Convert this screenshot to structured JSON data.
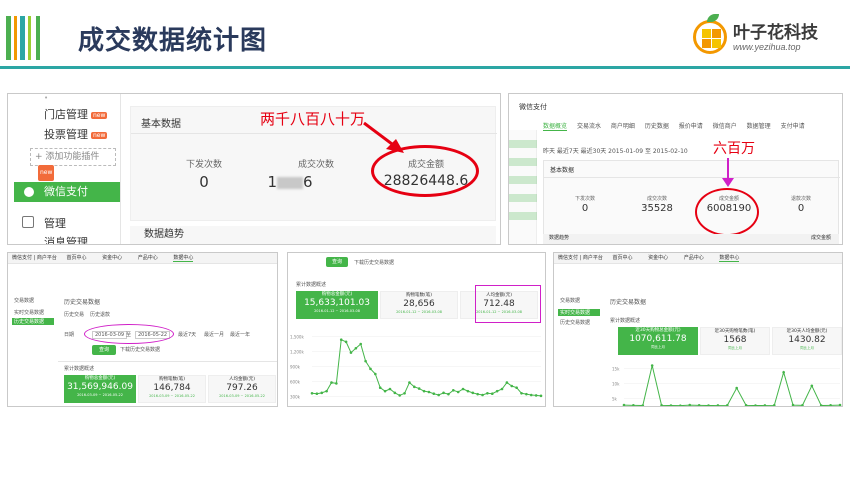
{
  "header": {
    "title": "成交数据统计图",
    "logo_name": "叶子花科技",
    "logo_url": "www.yezihua.top",
    "stripe_colors": [
      "#4caf50",
      "#f39800",
      "#2ca6a4",
      "#9acd32"
    ]
  },
  "shot1": {
    "sidebar": {
      "store_manage": "门店管理",
      "store_badge": "new",
      "invest_manage": "投票管理",
      "invest_badge": "new",
      "add_plugin": "+ 添加功能插件",
      "add_badge": "new",
      "wechat_pay": "微信支付",
      "manage": "管理",
      "message_manage": "消息管理"
    },
    "section_title": "基本数据",
    "stats": [
      {
        "label": "下发次数",
        "value": "0"
      },
      {
        "label": "成交次数",
        "value": "1"
      },
      {
        "label": "成交金额",
        "value": "28826448.6"
      }
    ],
    "obscured_suffix": "6",
    "annotation": "两千八百八十万",
    "trend_title": "数据趋势"
  },
  "shot2": {
    "title": "微信支付",
    "tabs": [
      "数据概览",
      "交易流水",
      "商户明细",
      "历史数据",
      "报价申请",
      "微信商户",
      "数据管理",
      "支付申请"
    ],
    "active_tab": 0,
    "filter": "昨天  最近7天  最近30天  2015-01-09 至 2015-02-10",
    "panel_title": "基本数据",
    "stats": [
      {
        "label": "下发次数",
        "value": "0"
      },
      {
        "label": "成交次数",
        "value": "35528"
      },
      {
        "label": "成交金额",
        "value": "6008190"
      },
      {
        "label": "退款次数",
        "value": "0"
      }
    ],
    "annotation": "六百万",
    "bottom_title": "数据趋势",
    "bottom_right": "成交金额"
  },
  "shot3": {
    "topbar": {
      "brand": "微信支付",
      "sub": "商户平台",
      "nav": [
        "首页中心",
        "资金中心",
        "产品中心",
        "数据中心"
      ],
      "active": 3
    },
    "side": {
      "section": "交易数据",
      "items": [
        "实时交易数据",
        "历史交易数据"
      ]
    },
    "page_title": "历史交易数据",
    "tabs": [
      "历史交易",
      "历史退款"
    ],
    "date_label": "日期",
    "date_from": "2016-03-09",
    "date_to": "2016-05-22",
    "quick": [
      "最近7天",
      "最近一月",
      "最近一年"
    ],
    "query_btn": "查询",
    "query_link": "下载历史交易数据",
    "chart_title": "累计数据概述",
    "stats": [
      {
        "label": "购物总金额(元)",
        "value": "31,569,946.09",
        "sub": "2016-03-09 ~ 2016-05-22"
      },
      {
        "label": "购物笔数(笔)",
        "value": "146,784",
        "sub": "2016-03-09 ~ 2016-05-22"
      },
      {
        "label": "人均金额(元)",
        "value": "797.26",
        "sub": "2016-03-09 ~ 2016-05-22"
      }
    ]
  },
  "shot4": {
    "top_btn": "查询",
    "top_link": "下载历史交易数据",
    "chart_title": "累计数据概述",
    "stats": [
      {
        "label": "购物总金额(元)",
        "value": "15,633,101.03",
        "sub": "2016-01-12 ~ 2016-03-08"
      },
      {
        "label": "购物笔数(笔)",
        "value": "28,656",
        "sub": "2016-01-12 ~ 2016-03-08"
      },
      {
        "label": "人均金额(元)",
        "value": "712.48",
        "sub": "2016-01-12 ~ 2016-03-08"
      }
    ],
    "chart_data": {
      "type": "line",
      "y_ticks": [
        "1,500k",
        "1,200k",
        "900k",
        "600k",
        "300k"
      ],
      "ylim": [
        0,
        1750000
      ],
      "values": [
        250000,
        240000,
        260000,
        300000,
        500000,
        480000,
        1500000,
        1450000,
        1200000,
        1300000,
        1400000,
        1000000,
        820000,
        700000,
        380000,
        300000,
        350000,
        260000,
        200000,
        250000,
        500000,
        400000,
        360000,
        300000,
        280000,
        240000,
        210000,
        260000,
        230000,
        320000,
        280000,
        350000,
        300000,
        260000,
        230000,
        210000,
        250000,
        240000,
        300000,
        350000,
        500000,
        420000,
        380000,
        250000,
        230000,
        210000,
        200000,
        190000
      ]
    }
  },
  "shot5": {
    "topbar": {
      "brand": "微信支付",
      "sub": "商户平台",
      "nav": [
        "首页中心",
        "资金中心",
        "产品中心",
        "数据中心"
      ],
      "active": 3
    },
    "side": {
      "section": "交易数据",
      "items": [
        "实时交易数据",
        "历史交易数据"
      ]
    },
    "page_title": "历史交易数据",
    "chart_title": "累计数据概述",
    "stats": [
      {
        "label": "近30天购物总金额(元)",
        "value": "1070,611.78",
        "sub": "同比上月"
      },
      {
        "label": "近30天购物笔数(笔)",
        "value": "1568",
        "sub": "同比上月"
      },
      {
        "label": "近30天人均金额(元)",
        "value": "1430.82",
        "sub": "同比上月"
      }
    ],
    "chart_data": {
      "type": "line",
      "y_ticks": [
        "15k",
        "10k",
        "5k"
      ],
      "ylim": [
        0,
        20000
      ],
      "values": [
        400,
        300,
        200,
        18000,
        300,
        200,
        150,
        400,
        300,
        200,
        250,
        300,
        8000,
        300,
        200,
        250,
        300,
        15000,
        400,
        300,
        9000,
        200,
        300,
        400
      ]
    }
  }
}
